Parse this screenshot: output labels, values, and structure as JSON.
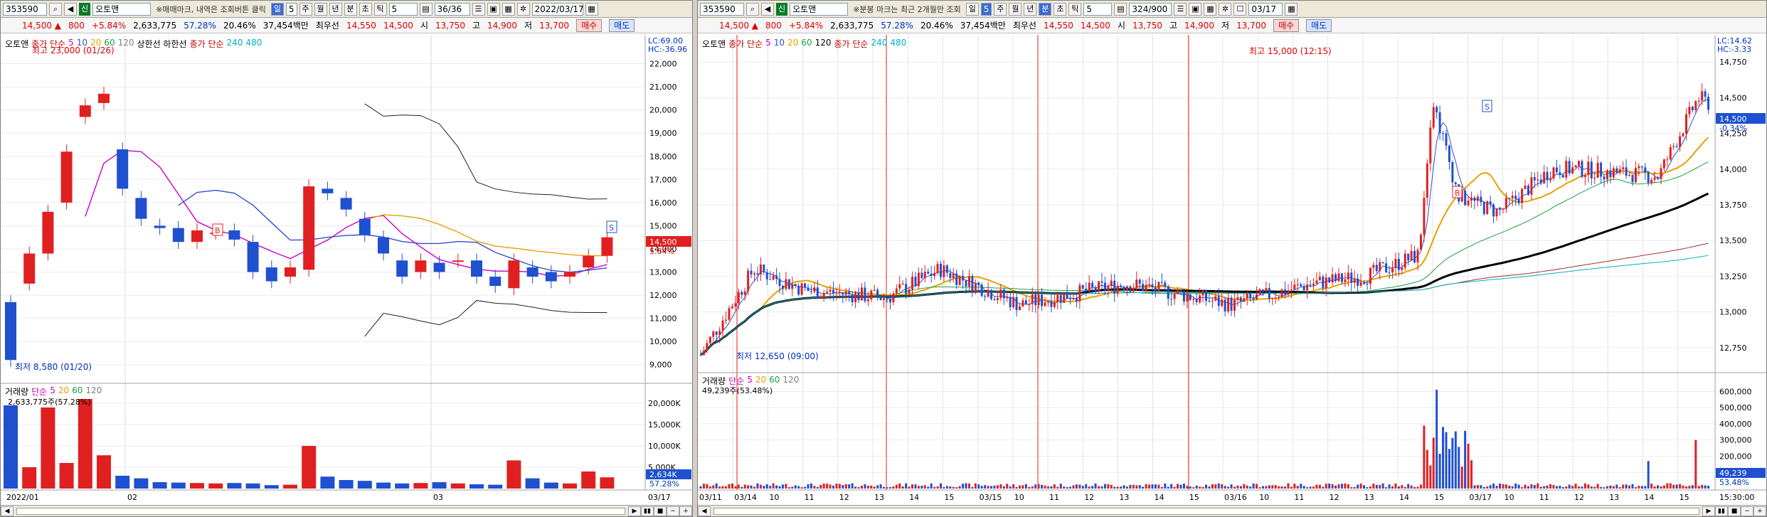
{
  "left": {
    "toolbar": {
      "code": "353590",
      "badge": "신",
      "stock_name": "오토앤",
      "message": "※매매마크, 내역은 조회버튼 클릭",
      "period_day": "일",
      "period_num": "5",
      "periods": [
        "주",
        "월",
        "년",
        "분",
        "초",
        "틱"
      ],
      "tick_count": "5",
      "counter": "36/36",
      "date": "2022/03/17"
    },
    "info": {
      "price": "14,500 ▲",
      "change": "800",
      "change_pct": "+5.84%",
      "volume": "2,633,775",
      "vol_ratio": "57.28%",
      "turnover": "20.46%",
      "amount": "37,454백만",
      "prev_label": "최우선",
      "bid": "14,550",
      "ask": "14,500",
      "open_label": "시",
      "open": "13,750",
      "high_label": "고",
      "high": "14,900",
      "low_label": "저",
      "low": "13,700",
      "buy_label": "매수",
      "sell_label": "매도"
    },
    "price_legend": {
      "name": "오토앤",
      "ma_label": "종가 단순",
      "ma_periods": [
        "5",
        "10",
        "20",
        "60",
        "120"
      ],
      "band_label": "상한선 하한선",
      "ma2_label": "종가 단순",
      "ma2_periods": [
        "240",
        "480"
      ]
    },
    "volume_legend": {
      "name": "거래량",
      "label": "단순",
      "periods": [
        "5",
        "20",
        "60",
        "120"
      ],
      "value": "2,633,775주(57.28%)"
    },
    "annotations": {
      "high": "최고 23,000 (01/26)",
      "low": "최저 8,580 (01/20)",
      "lc": "LC:69.00",
      "hc": "HC:-36.96",
      "price_tag": "14,500",
      "price_pct": "5.84%",
      "vol_tag": "2,634K",
      "vol_pct": "57.28%"
    },
    "price_axis": [
      "22,000",
      "21,000",
      "20,000",
      "19,000",
      "18,000",
      "17,000",
      "16,000",
      "15,000",
      "14,000",
      "13,000",
      "12,000",
      "11,000",
      "10,000",
      "9,000"
    ],
    "volume_axis": [
      "20,000K",
      "15,000K",
      "10,000K",
      "5,000K"
    ],
    "date_axis": [
      "2022/01",
      "02",
      "03",
      "03/17"
    ]
  },
  "right": {
    "toolbar": {
      "code": "353590",
      "badge": "신",
      "stock_name": "오토앤",
      "message": "※분봉 마크는 최근 2개월만 조회",
      "period_day": "일",
      "period_num": "5",
      "periods": [
        "주",
        "월",
        "년",
        "분",
        "초",
        "틱"
      ],
      "tick_count": "5",
      "counter": "324/900",
      "date": "03/17"
    },
    "info": {
      "price": "14,500 ▲",
      "change": "800",
      "change_pct": "+5.84%",
      "volume": "2,633,775",
      "vol_ratio": "57.28%",
      "turnover": "20.46%",
      "amount": "37,454백만",
      "prev_label": "최우선",
      "bid": "14,550",
      "ask": "14,500",
      "open_label": "시",
      "open": "13,750",
      "high_label": "고",
      "high": "14,900",
      "low_label": "저",
      "low": "13,700",
      "buy_label": "매수",
      "sell_label": "매도"
    },
    "price_legend": {
      "name": "오토앤",
      "ma_label": "종가 단순",
      "ma_periods": [
        "5",
        "10",
        "20",
        "60",
        "120"
      ],
      "ma2_label": "종가 단순",
      "ma2_periods": [
        "240",
        "480"
      ]
    },
    "volume_legend": {
      "name": "거래량",
      "label": "단순",
      "periods": [
        "5",
        "20",
        "60",
        "120"
      ],
      "value": "49,239주(53.48%)"
    },
    "annotations": {
      "high": "최고 15,000 (12:15)",
      "low": "최저 12,650 (09:00)",
      "lc": "LC:14.62",
      "hc": "HC:-3.33",
      "price_tag": "14,500",
      "price_pct": "-0.34%",
      "vol_tag": "49,239",
      "vol_pct": "53.48%"
    },
    "price_axis": [
      "14,750",
      "14,500",
      "14,250",
      "14,000",
      "13,750",
      "13,500",
      "13,250",
      "13,000",
      "12,750"
    ],
    "volume_axis": [
      "600,000",
      "500,000",
      "400,000",
      "300,000",
      "200,000",
      "100,000"
    ],
    "date_axis": [
      "03/11",
      "03/14",
      "10",
      "11",
      "12",
      "13",
      "14",
      "15",
      "03/15",
      "10",
      "11",
      "12",
      "13",
      "14",
      "15",
      "03/16",
      "10",
      "11",
      "12",
      "13",
      "14",
      "15",
      "03/17",
      "10",
      "11",
      "12",
      "13",
      "14",
      "15",
      "15:30:00"
    ]
  },
  "chart_data": [
    {
      "type": "candlestick",
      "title": "",
      "interval": "daily",
      "ylim": [
        8500,
        23000
      ],
      "candles": [
        {
          "o": 11700,
          "c": 9200
        },
        {
          "o": 12500,
          "c": 13800
        },
        {
          "o": 13800,
          "c": 15600
        },
        {
          "o": 16000,
          "c": 18200
        },
        {
          "o": 19700,
          "c": 20200
        },
        {
          "o": 20300,
          "c": 20700
        },
        {
          "o": 18300,
          "c": 16600
        },
        {
          "o": 16200,
          "c": 15300
        },
        {
          "o": 15000,
          "c": 14900
        },
        {
          "o": 14900,
          "c": 14300
        },
        {
          "o": 14300,
          "c": 14800
        },
        {
          "o": 14700,
          "c": 14700
        },
        {
          "o": 14800,
          "c": 14400
        },
        {
          "o": 14300,
          "c": 13000
        },
        {
          "o": 13200,
          "c": 12600
        },
        {
          "o": 12800,
          "c": 13200
        },
        {
          "o": 13100,
          "c": 16700
        },
        {
          "o": 16600,
          "c": 16400
        },
        {
          "o": 16200,
          "c": 15700
        },
        {
          "o": 15300,
          "c": 14600
        },
        {
          "o": 14500,
          "c": 13800
        },
        {
          "o": 13500,
          "c": 12800
        },
        {
          "o": 13000,
          "c": 13500
        },
        {
          "o": 13400,
          "c": 13000
        },
        {
          "o": 13500,
          "c": 13500
        },
        {
          "o": 13500,
          "c": 12800
        },
        {
          "o": 12800,
          "c": 12400
        },
        {
          "o": 12300,
          "c": 13500
        },
        {
          "o": 13200,
          "c": 12800
        },
        {
          "o": 13000,
          "c": 12600
        },
        {
          "o": 12800,
          "c": 13000
        },
        {
          "o": 13200,
          "c": 13700
        },
        {
          "o": 13700,
          "c": 14500
        }
      ],
      "volume_k": [
        19500,
        5000,
        19000,
        6000,
        21000,
        7800,
        3000,
        2400,
        1500,
        1400,
        1300,
        1200,
        1300,
        1200,
        800,
        900,
        10000,
        2800,
        2000,
        1800,
        1400,
        1200,
        1300,
        1500,
        1200,
        1000,
        900,
        6600,
        2400,
        1400,
        1200,
        4000,
        2634
      ]
    },
    {
      "type": "candlestick",
      "title": "",
      "interval": "5-minute",
      "ylim": [
        12600,
        14900
      ],
      "high": 15000,
      "low": 12650,
      "last": 14500
    }
  ],
  "colors": {
    "up": "#e02020",
    "down": "#1e50d0",
    "ma5": "#cc00cc",
    "ma10": "#3050d0",
    "ma20": "#e8a000",
    "ma60": "#20a040",
    "ma120": "#808080",
    "ma240": "#c00000",
    "ma480": "#00b0c0",
    "band": "#202020"
  }
}
